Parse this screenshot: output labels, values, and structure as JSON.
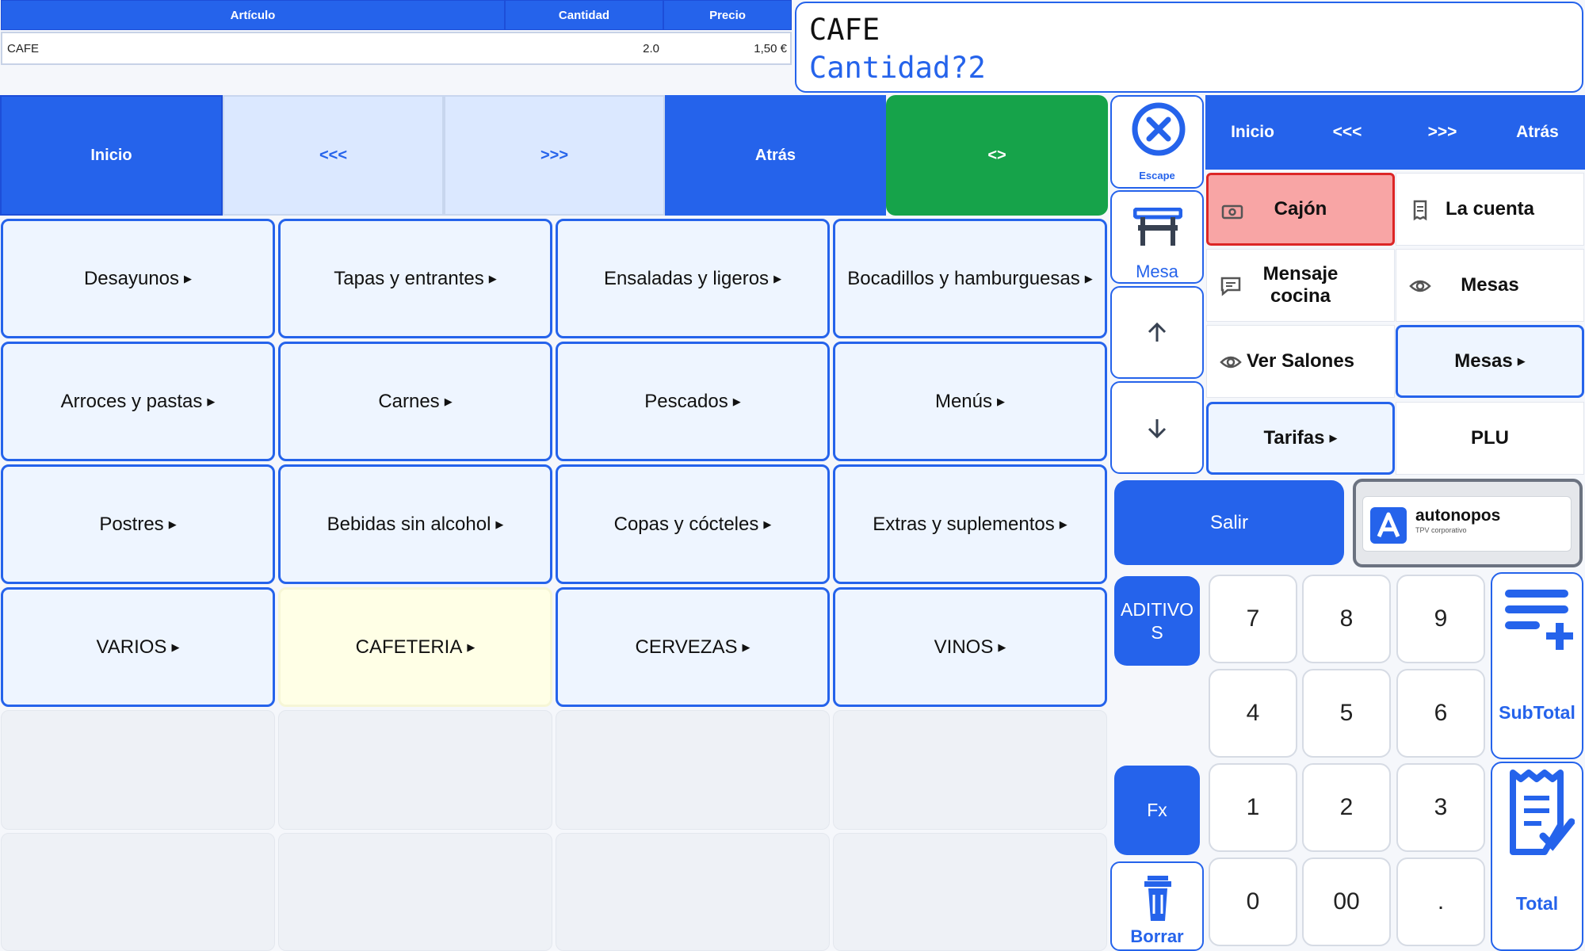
{
  "ticket": {
    "headers": {
      "article": "Artículo",
      "quantity": "Cantidad",
      "price": "Precio"
    },
    "rows": [
      {
        "article": "CAFE",
        "quantity": "2.0",
        "price": "1,50 €"
      }
    ]
  },
  "display": {
    "line1": "CAFE",
    "line2": "Cantidad?2"
  },
  "nav": {
    "home": "Inicio",
    "prev": "<<<",
    "next": ">>>",
    "back": "Atrás",
    "swap": "<>"
  },
  "categories": [
    "Desayunos",
    "Tapas y entrantes",
    "Ensaladas y ligeros",
    "Bocadillos y hamburguesas",
    "Arroces y pastas",
    "Carnes",
    "Pescados",
    "Menús",
    "Postres",
    "Bebidas sin alcohol",
    "Copas y cócteles",
    "Extras y suplementos",
    "VARIOS",
    "CAFETERIA",
    "CERVEZAS",
    "VINOS"
  ],
  "side": {
    "escape": "Escape",
    "table": "Mesa",
    "delete": "Borrar",
    "aditivos": "ADITIVOS",
    "fx": "Fx",
    "exit": "Salir"
  },
  "right_nav": {
    "home": "Inicio",
    "prev": "<<<",
    "next": ">>>",
    "back": "Atrás"
  },
  "actions": {
    "drawer": "Cajón",
    "bill": "La cuenta",
    "kitchen_msg": "Mensaje cocina",
    "tables": "Mesas",
    "view_rooms": "Ver Salones",
    "tables_menu": "Mesas",
    "rates": "Tarifas",
    "plu": "PLU"
  },
  "logo": {
    "name": "autonopos",
    "tagline": "TPV corporativo"
  },
  "keypad": [
    "7",
    "8",
    "9",
    "4",
    "5",
    "6",
    "1",
    "2",
    "3",
    "0",
    "00",
    "."
  ],
  "subtotal": "SubTotal",
  "total": "Total",
  "colors": {
    "accent": "#2563eb",
    "green": "#16a34a",
    "drawer": "#f8a5a5",
    "drawer_border": "#dc2626",
    "highlight": "#ffffe6"
  }
}
